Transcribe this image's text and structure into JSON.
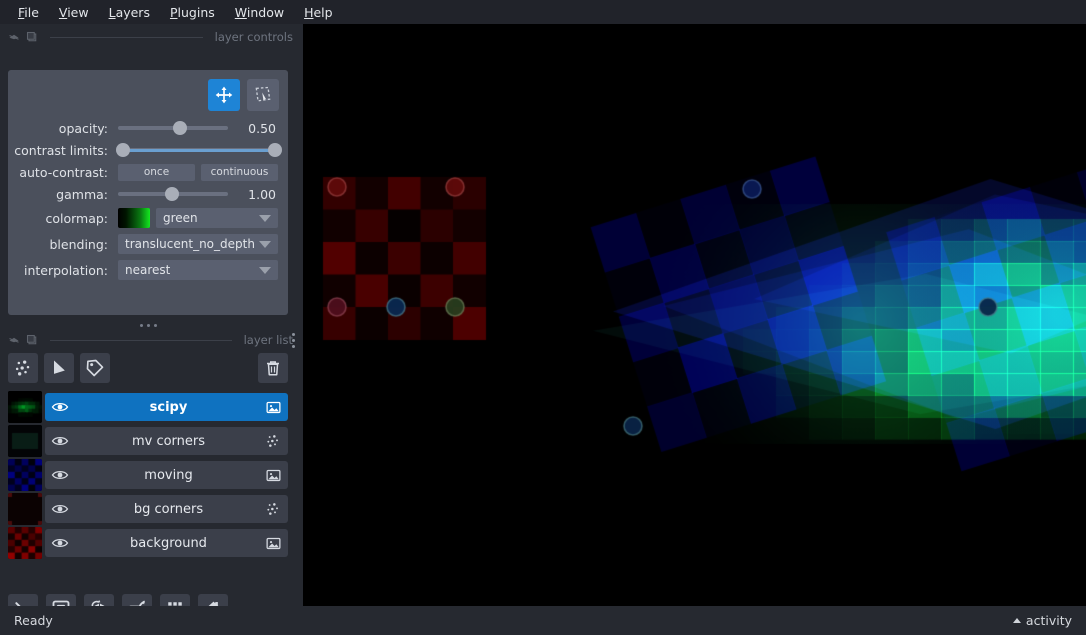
{
  "menubar": {
    "items": [
      {
        "label": "File",
        "mnemonic": "F"
      },
      {
        "label": "View",
        "mnemonic": "V"
      },
      {
        "label": "Layers",
        "mnemonic": "L"
      },
      {
        "label": "Plugins",
        "mnemonic": "P"
      },
      {
        "label": "Window",
        "mnemonic": "W"
      },
      {
        "label": "Help",
        "mnemonic": "H"
      }
    ]
  },
  "layer_controls": {
    "dock_title": "layer controls",
    "float_icon": "undock-icon",
    "close_icon": "window-icon",
    "mode_buttons": [
      {
        "name": "pan-zoom",
        "icon": "move-arrows-icon",
        "active": true
      },
      {
        "name": "transform",
        "icon": "transform-icon",
        "active": false
      }
    ],
    "opacity": {
      "label": "opacity:",
      "value": "0.50",
      "fraction": 0.5
    },
    "contrast_limits": {
      "label": "contrast limits:",
      "low": 0.0,
      "high": 1.0
    },
    "auto_contrast": {
      "label": "auto-contrast:",
      "once": "once",
      "continuous": "continuous"
    },
    "gamma": {
      "label": "gamma:",
      "value": "1.00",
      "fraction": 0.37
    },
    "colormap": {
      "label": "colormap:",
      "value": "green"
    },
    "blending": {
      "label": "blending:",
      "value": "translucent_no_depth"
    },
    "interpolation": {
      "label": "interpolation:",
      "value": "nearest"
    }
  },
  "layer_list": {
    "dock_title": "layer list",
    "float_icon": "undock-icon",
    "close_icon": "window-icon",
    "menu_icon": "kebab-menu-icon",
    "toolbar": [
      {
        "name": "new-points-layer",
        "icon": "points-icon",
        "tooltip": "New points layer"
      },
      {
        "name": "new-shapes-layer",
        "icon": "shapes-icon",
        "tooltip": "New shapes layer"
      },
      {
        "name": "new-labels-layer",
        "icon": "labels-tag-icon",
        "tooltip": "New labels layer"
      },
      {
        "name": "delete-layer",
        "icon": "trash-icon",
        "tooltip": "Delete selected layers"
      }
    ],
    "layers": [
      {
        "name": "scipy",
        "type": "image",
        "visible": true,
        "selected": true,
        "thumb": "green-blob"
      },
      {
        "name": "mv corners",
        "type": "points",
        "visible": true,
        "selected": false,
        "thumb": "dark"
      },
      {
        "name": "moving",
        "type": "image",
        "visible": true,
        "selected": false,
        "thumb": "blue-checker"
      },
      {
        "name": "bg corners",
        "type": "points",
        "visible": true,
        "selected": false,
        "thumb": "dark-red"
      },
      {
        "name": "background",
        "type": "image",
        "visible": true,
        "selected": false,
        "thumb": "red-checker"
      }
    ]
  },
  "viewer_buttons": [
    {
      "name": "console-button",
      "icon": "console-prompt-icon",
      "tooltip": "Open IPython console"
    },
    {
      "name": "ndisplay-button",
      "icon": "square-2d-icon",
      "tooltip": "Toggle 2D/3D view"
    },
    {
      "name": "roll-dims-button",
      "icon": "cube-3d-icon",
      "tooltip": "Roll dimensions"
    },
    {
      "name": "transpose-dims-button",
      "icon": "transpose-icon",
      "tooltip": "Transpose dimensions"
    },
    {
      "name": "grid-view-button",
      "icon": "grid-icon",
      "tooltip": "Toggle grid view"
    },
    {
      "name": "home-button",
      "icon": "home-icon",
      "tooltip": "Reset view"
    }
  ],
  "statusbar": {
    "status": "Ready",
    "activity_label": "activity",
    "activity_icon": "caret-up-icon"
  },
  "canvas": {
    "name": "viewer-canvas",
    "background": "#000000",
    "layers_rendered": [
      "background",
      "bg corners",
      "moving",
      "mv corners",
      "scipy"
    ],
    "accent_green": "#0fa033",
    "accent_blue": "#0a1a6e",
    "accent_red": "#6a0b0b"
  },
  "colors": {
    "app_bg": "#262930",
    "panel_bg": "#4b505c",
    "widget_bg": "#5a6070",
    "row_bg": "#3b3f4a",
    "selected_row": "#0f72c0",
    "accent": "#1e84d6",
    "text": "#d2d5da",
    "muted_text": "#6e747f"
  }
}
